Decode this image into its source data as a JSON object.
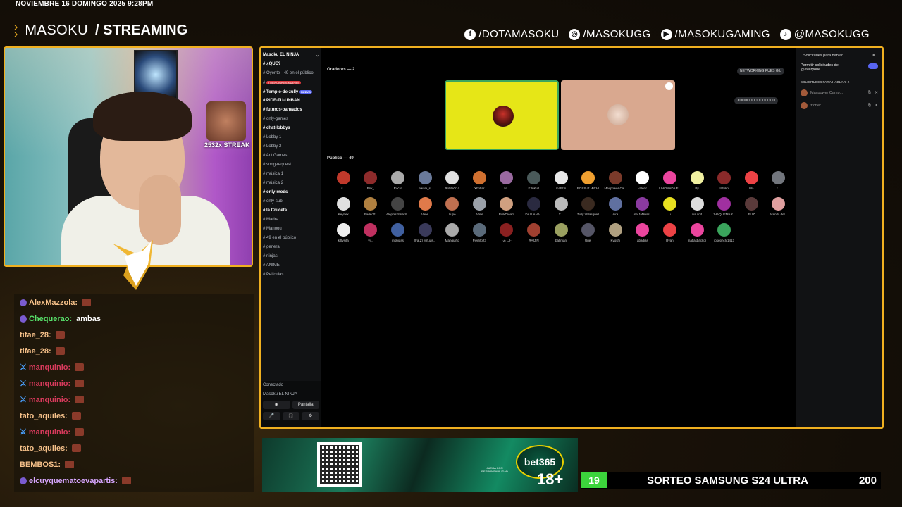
{
  "overlay": {
    "date": "NOVIEMBRE 16 DOMINGO 2025 9:28PM",
    "brand_name": "MASOKU",
    "brand_section": "/ STREAMING",
    "socials": [
      {
        "icon": "facebook-icon",
        "label": "/DOTAMASOKU"
      },
      {
        "icon": "instagram-icon",
        "label": "/MASOKUGG"
      },
      {
        "icon": "youtube-icon",
        "label": "/MASOKUGAMING"
      },
      {
        "icon": "tiktok-icon",
        "label": "@MASOKUGG"
      }
    ],
    "streak": "2532x STREAK",
    "accent": "#f0b020"
  },
  "chat": {
    "messages": [
      {
        "user": "AlexMazzola:",
        "color": "#f5c089",
        "msg": "",
        "emote": true,
        "sword": false
      },
      {
        "user": "Chequerao:",
        "color": "#57e06a",
        "msg": "ambas",
        "emote": false,
        "sword": false
      },
      {
        "user": "tifae_28:",
        "color": "#f5c089",
        "msg": "",
        "emote": true,
        "sword": false
      },
      {
        "user": "tifae_28:",
        "color": "#f5c089",
        "msg": "",
        "emote": true,
        "sword": false
      },
      {
        "user": "manquinio:",
        "color": "#d93a5c",
        "msg": "",
        "emote": true,
        "sword": true
      },
      {
        "user": "manquinio:",
        "color": "#d93a5c",
        "msg": "",
        "emote": true,
        "sword": true
      },
      {
        "user": "manquinio:",
        "color": "#d93a5c",
        "msg": "",
        "emote": true,
        "sword": true
      },
      {
        "user": "tato_aquiles:",
        "color": "#f5c089",
        "msg": "",
        "emote": true,
        "sword": false
      },
      {
        "user": "manquinio:",
        "color": "#d93a5c",
        "msg": "",
        "emote": true,
        "sword": true
      },
      {
        "user": "tato_aquiles:",
        "color": "#f5c089",
        "msg": "",
        "emote": true,
        "sword": false
      },
      {
        "user": "BEMBOS1:",
        "color": "#f5c089",
        "msg": "",
        "emote": true,
        "sword": false
      },
      {
        "user": "elcuyquematoevapartis:",
        "color": "#d7a6ff",
        "msg": "",
        "emote": true,
        "sword": false
      }
    ]
  },
  "discord": {
    "server_name": "Masoku EL NINJA",
    "sidebar": [
      {
        "text": "¿QUE?",
        "bold": true
      },
      {
        "text": "Oyente · 49 en el público",
        "bold": false
      },
      {
        "text": "2 MENCIONES NUEVAS",
        "bold": false,
        "pill": "red"
      },
      {
        "text": "Templo-de-zully",
        "bold": true,
        "pill": "blue",
        "pill_text": "NUEVO"
      },
      {
        "text": "PIDE-TU-UNBAN",
        "bold": true
      },
      {
        "text": "futuros-baneados",
        "bold": true
      },
      {
        "text": "only-games",
        "bold": false
      },
      {
        "text": "chat-lobbys",
        "bold": true
      },
      {
        "text": "Lobby 1",
        "bold": false
      },
      {
        "text": "Lobby 2",
        "bold": false
      },
      {
        "text": "AntiGames",
        "bold": false
      },
      {
        "text": "song-request",
        "bold": false
      },
      {
        "text": "música 1",
        "bold": false
      },
      {
        "text": "música 2",
        "bold": false
      },
      {
        "text": "only-mods",
        "bold": true
      },
      {
        "text": "only-sub",
        "bold": false
      },
      {
        "text": "la Cruceta",
        "bold": true
      },
      {
        "text": "Madra",
        "bold": false
      },
      {
        "text": "Manoou",
        "bold": false
      },
      {
        "text": "49 en el público",
        "bold": false
      },
      {
        "text": "general",
        "bold": false
      },
      {
        "text": "ninjas",
        "bold": false
      },
      {
        "text": "ANIME",
        "bold": false
      },
      {
        "text": "Películas",
        "bold": false
      }
    ],
    "user_status": "Conectado",
    "user_sub": "Masoku EL NINJA",
    "screen_button": "Pantalla",
    "speakers_header": "Oradores — 2",
    "public_header": "Público — 49",
    "speaker_tags": [
      "NETWORKING PUES GIL",
      "XDDDDDDDDDDDDDD"
    ],
    "audience": [
      {
        "name": "s...",
        "color": "#c0392b"
      },
      {
        "name": "Brik_",
        "color": "#8e2b2b"
      },
      {
        "name": "Rocío",
        "color": "#aaaaaa"
      },
      {
        "name": "ewala_si",
        "color": "#6a7a9a"
      },
      {
        "name": "RoMeO14",
        "color": "#e0e0e0"
      },
      {
        "name": "Xbotter",
        "color": "#d07030"
      },
      {
        "name": "N...",
        "color": "#9a6aa0"
      },
      {
        "name": "K3nKu1",
        "color": "#4a5a5a"
      },
      {
        "name": "maRt!n",
        "color": "#e8e8e8"
      },
      {
        "name": "BOSS of MICHI",
        "color": "#f0a030"
      },
      {
        "name": "Maxpower Ca...",
        "color": "#7a3a2a"
      },
      {
        "name": "valerio",
        "color": "#ffffff"
      },
      {
        "name": "LIMONADA F...",
        "color": "#eb459e"
      },
      {
        "name": "By",
        "color": "#f0f0a0"
      },
      {
        "name": "Ir3nko",
        "color": "#8a2a2a"
      },
      {
        "name": "Wa",
        "color": "#ed4245"
      },
      {
        "name": "c...",
        "color": "#72767d"
      },
      {
        "name": "Keynex",
        "color": "#e0e0e0"
      },
      {
        "name": "Faded01",
        "color": "#b08040"
      },
      {
        "name": "Alepols Sala S...",
        "color": "#444"
      },
      {
        "name": "Vane",
        "color": "#e07a4a"
      },
      {
        "name": "Lupe",
        "color": "#c07050"
      },
      {
        "name": "Adee",
        "color": "#9aa0a8"
      },
      {
        "name": "PinkDream",
        "color": "#d0a080"
      },
      {
        "name": "DALLANA...",
        "color": "#2a2a40"
      },
      {
        "name": "C...",
        "color": "#bbb"
      },
      {
        "name": "Zully Velasquez",
        "color": "#3a2a20"
      },
      {
        "name": "Aira",
        "color": "#6070a0"
      },
      {
        "name": "Ale JaMess...",
        "color": "#8a3aa0"
      },
      {
        "name": "Li",
        "color": "#e8e020"
      },
      {
        "name": "ais.and",
        "color": "#ddd"
      },
      {
        "name": "JHAQUEMAR...",
        "color": "#a030a0"
      },
      {
        "name": "ELIZ",
        "color": "#5a3a3a"
      },
      {
        "name": "Arenita del...",
        "color": "#e0a0a0"
      },
      {
        "name": "kittysita",
        "color": "#eee"
      },
      {
        "name": "vi...",
        "color": "#c03060"
      },
      {
        "name": "mobiass",
        "color": "#4060a0"
      },
      {
        "name": "(Fa.Z) MrLuis...",
        "color": "#3a3a5a"
      },
      {
        "name": "Manquiño",
        "color": "#aaa"
      },
      {
        "name": "Pierrito23",
        "color": "#5a6a7a"
      },
      {
        "name": "-ایـ_ٹ-",
        "color": "#8a2020"
      },
      {
        "name": "RAIJIN",
        "color": "#a04030"
      },
      {
        "name": "batimán",
        "color": "#9aa060"
      },
      {
        "name": "Uriel",
        "color": "#556"
      },
      {
        "name": "Kyoshi",
        "color": "#b0a080"
      },
      {
        "name": "abadias",
        "color": "#eb459e"
      },
      {
        "name": "Ryan",
        "color": "#ed4245"
      },
      {
        "name": "matiasbackor",
        "color": "#eb459e"
      },
      {
        "name": "josephclv1413",
        "color": "#3ba55d"
      }
    ],
    "panel": {
      "title": "Solicitudes para hablar",
      "toggle_label": "Permitir solicitudes de @everyone",
      "requests_header": "SOLICITUDES PARA HABLAR: 2",
      "requests": [
        {
          "name": "Maxpower Camp...",
          "sub": "Miembro con rol(es)"
        },
        {
          "name": "zlotter",
          "sub": ""
        }
      ]
    }
  },
  "ad": {
    "brand": "bet365",
    "age": "18+",
    "fine_print": "JUEGA CON RESPONSABILIDAD"
  },
  "sorteo": {
    "count": "19",
    "label": "SORTEO SAMSUNG S24 ULTRA",
    "goal": "200"
  }
}
